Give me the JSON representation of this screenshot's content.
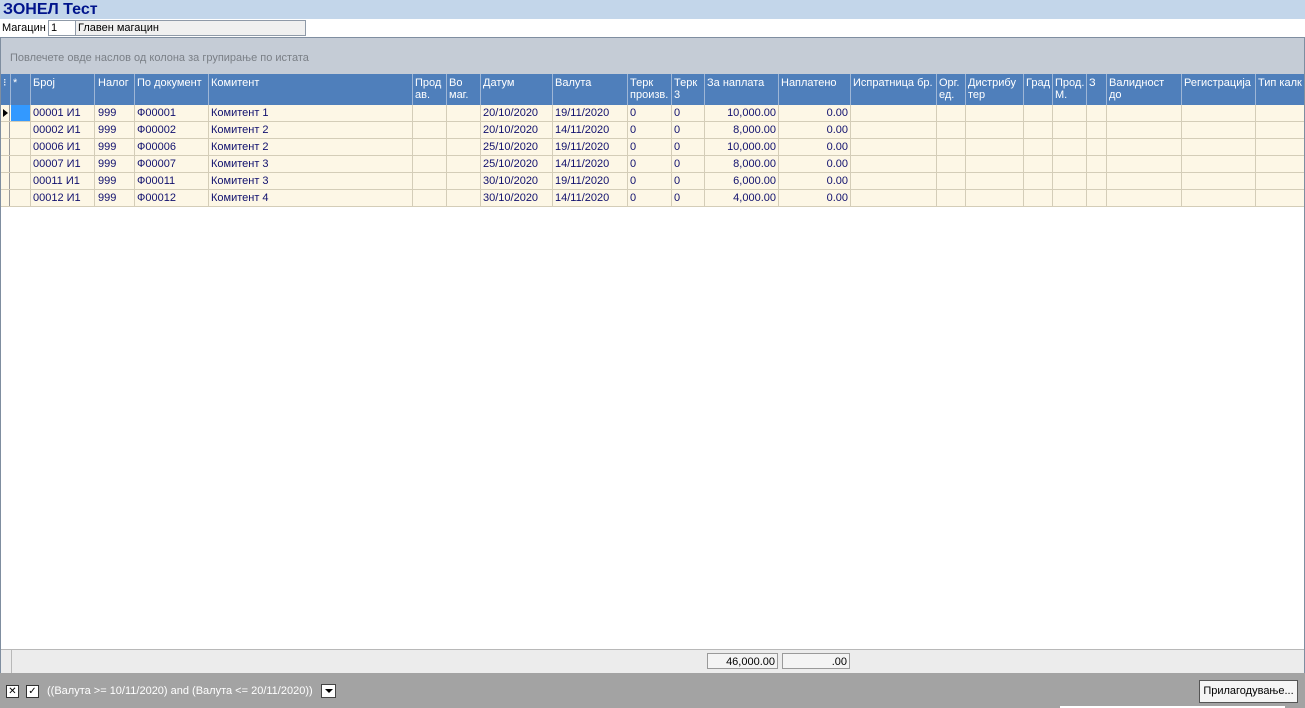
{
  "title": "ЗОНЕЛ Тест",
  "warehouse": {
    "label": "Магацин",
    "code": "1",
    "name": "Главен магацин"
  },
  "group_hint": "Повлечете овде наслов од колона за групирање по истата",
  "columns": [
    {
      "key": "broj",
      "label": "Број"
    },
    {
      "key": "nalog",
      "label": "Налог"
    },
    {
      "key": "po_dok",
      "label": "По документ"
    },
    {
      "key": "komitent",
      "label": "Комитент"
    },
    {
      "key": "prod_av",
      "label": "Прод\nав."
    },
    {
      "key": "vo_mag",
      "label": "Во\nмаг."
    },
    {
      "key": "datum",
      "label": "Датум"
    },
    {
      "key": "valuta",
      "label": "Валута"
    },
    {
      "key": "terk_proiz",
      "label": "Терк\nпроизв."
    },
    {
      "key": "terk3",
      "label": "Терк\n3"
    },
    {
      "key": "za_naplata",
      "label": "За наплата"
    },
    {
      "key": "naplateno",
      "label": "Наплатено"
    },
    {
      "key": "ispratnica",
      "label": "Испратница бр."
    },
    {
      "key": "org_ed",
      "label": "Орг.\nед."
    },
    {
      "key": "distributer",
      "label": "Дистрибу\nтер"
    },
    {
      "key": "grad",
      "label": "Град"
    },
    {
      "key": "prod_m",
      "label": "Прод.\nМ."
    },
    {
      "key": "z",
      "label": "З"
    },
    {
      "key": "validnost",
      "label": "Валидност до"
    },
    {
      "key": "registracija",
      "label": "Регистрација"
    },
    {
      "key": "tip_kalk",
      "label": "Тип калк"
    }
  ],
  "rows": [
    {
      "broj": "00001  И1",
      "nalog": "999",
      "po_dok": "Ф00001",
      "komitent": "Комитент 1",
      "datum": "20/10/2020",
      "valuta": "19/11/2020",
      "terk_proiz": "0",
      "terk3": "0",
      "za_naplata": "10,000.00",
      "naplateno": "0.00"
    },
    {
      "broj": "00002  И1",
      "nalog": "999",
      "po_dok": "Ф00002",
      "komitent": "Комитент 2",
      "datum": "20/10/2020",
      "valuta": "14/11/2020",
      "terk_proiz": "0",
      "terk3": "0",
      "za_naplata": "8,000.00",
      "naplateno": "0.00"
    },
    {
      "broj": "00006  И1",
      "nalog": "999",
      "po_dok": "Ф00006",
      "komitent": "Комитент 2",
      "datum": "25/10/2020",
      "valuta": "19/11/2020",
      "terk_proiz": "0",
      "terk3": "0",
      "za_naplata": "10,000.00",
      "naplateno": "0.00"
    },
    {
      "broj": "00007  И1",
      "nalog": "999",
      "po_dok": "Ф00007",
      "komitent": "Комитент 3",
      "datum": "25/10/2020",
      "valuta": "14/11/2020",
      "terk_proiz": "0",
      "terk3": "0",
      "za_naplata": "8,000.00",
      "naplateno": "0.00"
    },
    {
      "broj": "00011  И1",
      "nalog": "999",
      "po_dok": "Ф00011",
      "komitent": "Комитент 3",
      "datum": "30/10/2020",
      "valuta": "19/11/2020",
      "terk_proiz": "0",
      "terk3": "0",
      "za_naplata": "6,000.00",
      "naplateno": "0.00"
    },
    {
      "broj": "00012  И1",
      "nalog": "999",
      "po_dok": "Ф00012",
      "komitent": "Комитент 4",
      "datum": "30/10/2020",
      "valuta": "14/11/2020",
      "terk_proiz": "0",
      "terk3": "0",
      "za_naplata": "4,000.00",
      "naplateno": "0.00"
    }
  ],
  "totals": {
    "za_naplata": "46,000.00",
    "naplateno": ".00"
  },
  "filter": {
    "clear_icon": "close-icon",
    "enable_icon": "checkmark-icon",
    "expression": "((Валута >= 10/11/2020) and (Валута <= 20/11/2020))"
  },
  "customize_label": "Прилагодување..."
}
